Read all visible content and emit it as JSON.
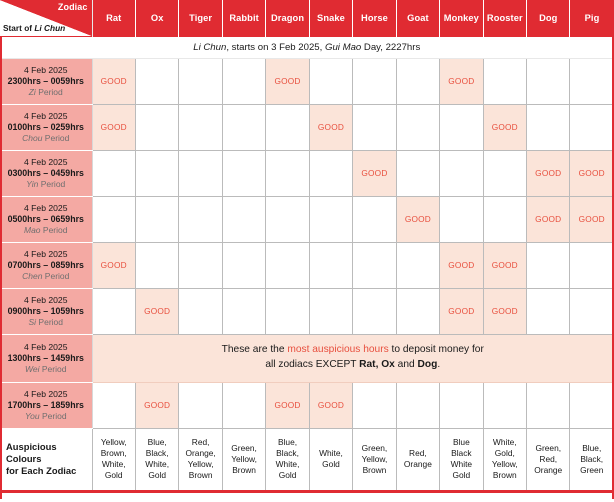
{
  "corner": {
    "zodiac_label": "Zodiac",
    "start_label_prefix": "Start of ",
    "start_label_italic": "Li Chun"
  },
  "zodiacs": [
    "Rat",
    "Ox",
    "Tiger",
    "Rabbit",
    "Dragon",
    "Snake",
    "Horse",
    "Goat",
    "Monkey",
    "Rooster",
    "Dog",
    "Pig"
  ],
  "subtitle": {
    "italic1": "Li Chun",
    "text1": ", starts on 3 Feb 2025, ",
    "italic2": "Gui Mao",
    "text2": " Day, 2227hrs"
  },
  "good_label": "GOOD",
  "rows": [
    {
      "date": "4 Feb 2025",
      "time": "2300hrs – 0059hrs",
      "period_italic": "Zi",
      "period_suffix": " Period",
      "good": [
        true,
        false,
        false,
        false,
        true,
        false,
        false,
        false,
        true,
        false,
        false,
        false
      ]
    },
    {
      "date": "4 Feb 2025",
      "time": "0100hrs – 0259hrs",
      "period_italic": "Chou",
      "period_suffix": " Period",
      "good": [
        true,
        false,
        false,
        false,
        false,
        true,
        false,
        false,
        false,
        true,
        false,
        false
      ]
    },
    {
      "date": "4 Feb 2025",
      "time": "0300hrs – 0459hrs",
      "period_italic": "Yin",
      "period_suffix": " Period",
      "good": [
        false,
        false,
        false,
        false,
        false,
        false,
        true,
        false,
        false,
        false,
        true,
        true
      ]
    },
    {
      "date": "4 Feb 2025",
      "time": "0500hrs – 0659hrs",
      "period_italic": "Mao",
      "period_suffix": " Period",
      "good": [
        false,
        false,
        false,
        false,
        false,
        false,
        false,
        true,
        false,
        false,
        true,
        true
      ]
    },
    {
      "date": "4 Feb 2025",
      "time": "0700hrs – 0859hrs",
      "period_italic": "Chen",
      "period_suffix": " Period",
      "good": [
        true,
        false,
        false,
        false,
        false,
        false,
        false,
        false,
        true,
        true,
        false,
        false
      ]
    },
    {
      "date": "4 Feb 2025",
      "time": "0900hrs – 1059hrs",
      "period_italic": "Si",
      "period_suffix": " Period",
      "good": [
        false,
        true,
        false,
        false,
        false,
        false,
        false,
        false,
        true,
        true,
        false,
        false
      ]
    },
    {
      "date": "4 Feb 2025",
      "time": "1300hrs – 1459hrs",
      "period_italic": "Wei",
      "period_suffix": " Period",
      "banner": true
    },
    {
      "date": "4 Feb 2025",
      "time": "1700hrs – 1859hrs",
      "period_italic": "You",
      "period_suffix": " Period",
      "good": [
        false,
        true,
        false,
        false,
        true,
        true,
        false,
        false,
        false,
        false,
        false,
        false
      ]
    }
  ],
  "banner": {
    "part1": "These are the ",
    "highlight": "most auspicious hours",
    "part2": " to deposit money for",
    "line2_pre": "all zodiacs EXCEPT ",
    "line2_b1": "Rat, Ox",
    "line2_mid": " and ",
    "line2_b2": "Dog",
    "line2_end": "."
  },
  "colours_row": {
    "header_line1": "Auspicious",
    "header_line2": "Colours",
    "header_line3": "for Each Zodiac",
    "values": [
      "Yellow,\nBrown,\nWhite,\nGold",
      "Blue,\nBlack,\nWhite,\nGold",
      "Red,\nOrange,\nYellow,\nBrown",
      "Green,\nYellow,\nBrown",
      "Blue,\nBlack,\nWhite,\nGold",
      "White,\nGold",
      "Green,\nYellow,\nBrown",
      "Red,\nOrange",
      "Blue\nBlack\nWhite\nGold",
      "White,\nGold,\nYellow,\nBrown",
      "Green,\nRed,\nOrange",
      "Blue,\nBlack,\nGreen"
    ]
  },
  "colors": {
    "header_red": "#e02b32",
    "period_pink": "#f4a9a3",
    "good_bg": "#fbe4d9",
    "good_text": "#e8503f"
  }
}
